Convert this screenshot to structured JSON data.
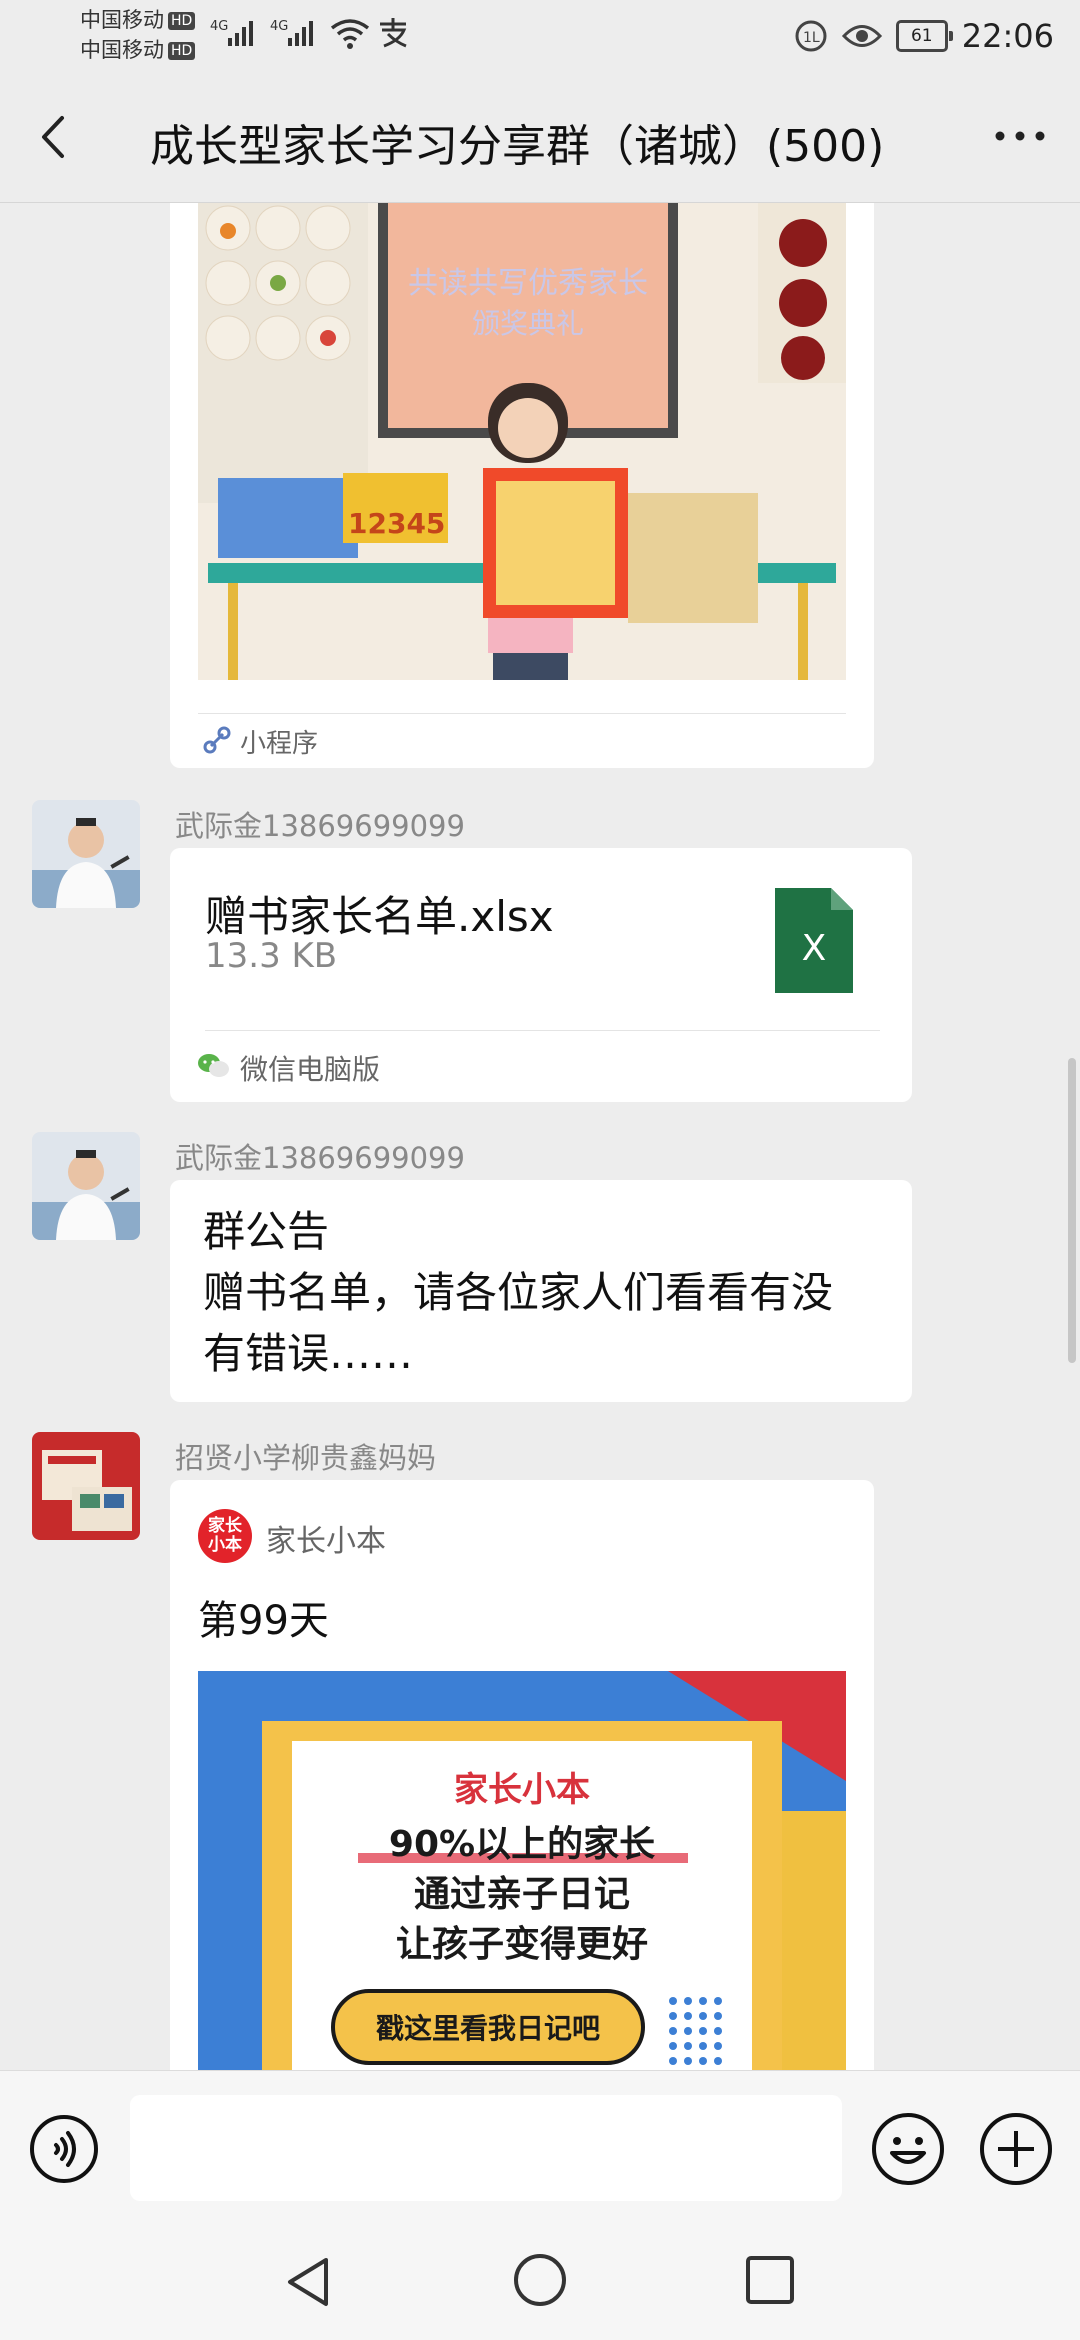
{
  "status_bar": {
    "carrier_1": "中国移动",
    "carrier_2": "中国移动",
    "hd_badge": "HD",
    "network_1": "4G",
    "network_2": "4G",
    "battery": "61",
    "time": "22:06"
  },
  "header": {
    "title": "成长型家长学习分享群（诸城）(500)"
  },
  "messages": {
    "mini_program": {
      "label": "小程序",
      "image_banner_line1": "共读共写优秀家长",
      "image_banner_line2": "颁奖典礼"
    },
    "file": {
      "sender": "武际金13869699099",
      "file_name": "赠书家长名单.xlsx",
      "file_size": "13.3 KB",
      "file_icon_letter": "X",
      "source": "微信电脑版"
    },
    "notice": {
      "sender": "武际金13869699099",
      "title": "群公告",
      "body_line1": "赠书名单，请各位家人们看看有没",
      "body_line2": "有错误……"
    },
    "article": {
      "sender": "招贤小学柳贵鑫妈妈",
      "app_logo_text": "家长小本",
      "app_name": "家长小本",
      "title": "第99天",
      "promo_brand": "家长小本",
      "promo_line1": "90%以上的家长",
      "promo_line2": "通过亲子日记",
      "promo_line3": "让孩子变得更好",
      "promo_button": "戳这里看我日记吧"
    }
  },
  "input_bar": {
    "placeholder": ""
  },
  "colors": {
    "background": "#ededed",
    "excel_green": "#1f7244",
    "brand_red": "#e2232a",
    "link_blue": "#5a7bbd"
  }
}
